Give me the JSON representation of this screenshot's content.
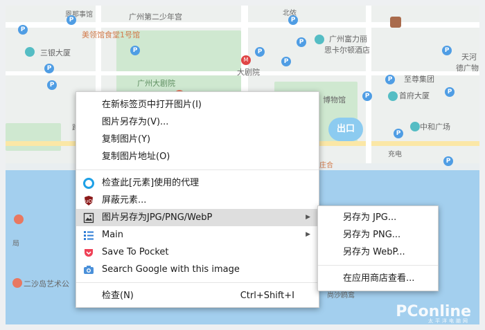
{
  "map": {
    "labels": {
      "zhuangshi": "恩那事馆",
      "shaoniangong": "广州第二少年宫",
      "beiyuan": "北侬",
      "meiling": "美领馆食堂1号馆",
      "fuli": "广州富力丽",
      "sikadun": "思卡尔顿酒店",
      "sanyin": "三银大厦",
      "dajuyuan": "广州大剧院",
      "dajuyuan2": "大剧院",
      "zhihe": "至尊集团",
      "tianhe": "天河",
      "deguang": "德广物",
      "bowuguan": "博物馆",
      "shoufu": "首府大厦",
      "zhonghe": "中和广场",
      "chongdian": "充电",
      "ersha": "二沙岛艺术公",
      "shaoju": "局",
      "zhuangjian": "庄合",
      "shaguo": "尚沙鸥鸾",
      "lu": "路"
    },
    "exit_label": "出口",
    "metro_label": "M",
    "poi_label": "P",
    "watermark": "PConline",
    "watermark_sub": "太平洋电脑网"
  },
  "context_menu": {
    "items": [
      {
        "label": "在新标签页中打开图片(I)"
      },
      {
        "label": "图片另存为(V)..."
      },
      {
        "label": "复制图片(Y)"
      },
      {
        "label": "复制图片地址(O)"
      },
      {
        "label": "检查此[元素]使用的代理",
        "icon": "proxy-icon"
      },
      {
        "label": "屏蔽元素...",
        "icon": "ublock-icon"
      },
      {
        "label": "图片另存为JPG/PNG/WebP",
        "icon": "image-icon"
      },
      {
        "label": "Main",
        "icon": "list-icon"
      },
      {
        "label": "Save To Pocket",
        "icon": "pocket-icon"
      },
      {
        "label": "Search Google with this image",
        "icon": "camera-icon"
      },
      {
        "label": "检查(N)",
        "shortcut": "Ctrl+Shift+I"
      }
    ]
  },
  "submenu": {
    "items": [
      {
        "label": "另存为 JPG..."
      },
      {
        "label": "另存为 PNG..."
      },
      {
        "label": "另存为 WebP..."
      },
      {
        "label": "在应用商店查看..."
      }
    ]
  },
  "colors": {
    "accent": "#1a73e8",
    "highlight": "#dedede",
    "river": "#a3cfee",
    "park": "#cfe8d0"
  }
}
